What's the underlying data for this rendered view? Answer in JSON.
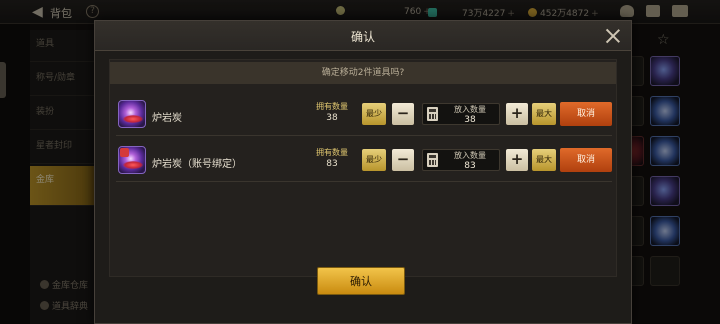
{
  "background": {
    "title": "背包",
    "help": "?",
    "currency": [
      {
        "value": "760",
        "icon": "moon-coin-icon",
        "color": "#c9c27a"
      },
      {
        "value": "73万4227",
        "icon": "gem-icon",
        "color": "#3fc4a8"
      },
      {
        "value": "452万4872",
        "icon": "gold-coin-icon",
        "color": "#e0b13a"
      }
    ],
    "plus": "+",
    "sidebar": [
      "道具",
      "称号/勋章",
      "装扮",
      "星者封印",
      "金库"
    ],
    "bottom_links": [
      "金库仓库",
      "道具辞典"
    ]
  },
  "dialog": {
    "title": "确认",
    "prompt": "确定移动2件道具吗?",
    "min_label": "最少",
    "max_label": "最大",
    "minus": "−",
    "plus": "+",
    "owned_label": "拥有数量",
    "put_label": "放入数量",
    "cancel_label": "取消",
    "confirm_label": "确认",
    "items": [
      {
        "name": "炉岩炭",
        "owned": "38",
        "put": "38"
      },
      {
        "name": "炉岩炭（账号绑定）",
        "owned": "83",
        "put": "83"
      }
    ]
  }
}
